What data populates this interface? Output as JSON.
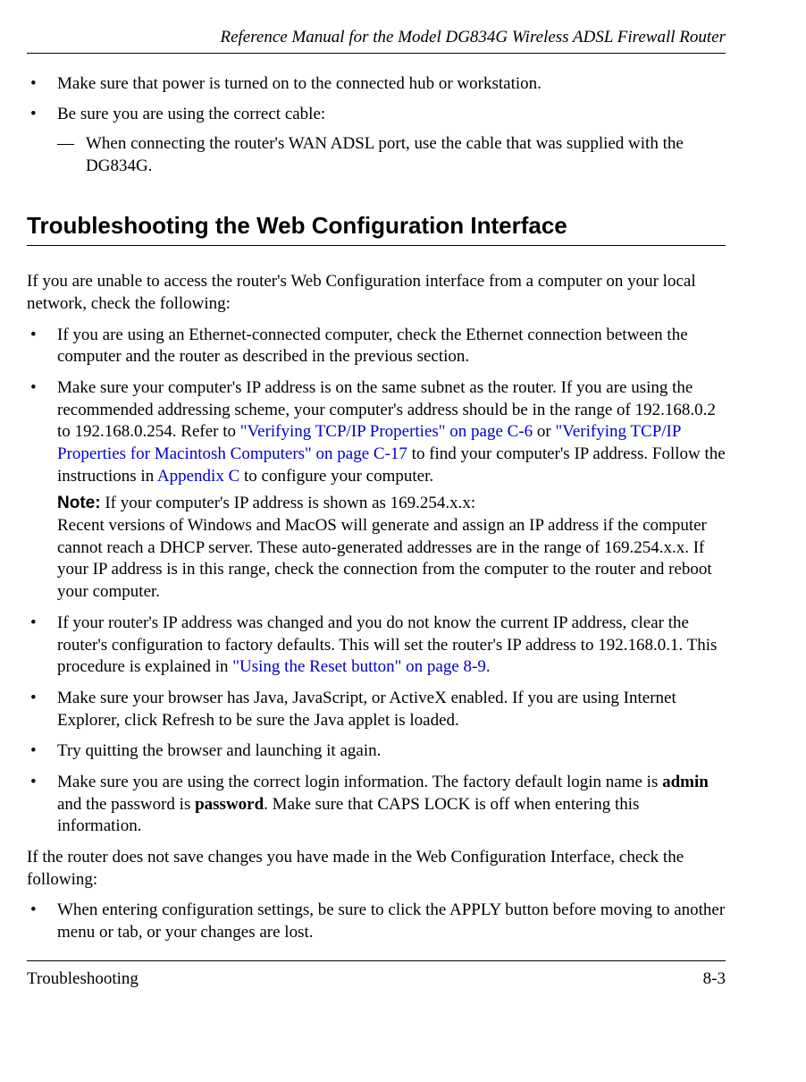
{
  "header": {
    "running_title": "Reference Manual for the Model DG834G Wireless ADSL Firewall Router"
  },
  "top_bullets": {
    "b1": "Make sure that power is turned on to the connected hub or workstation.",
    "b2": "Be sure you are using the correct cable:",
    "b2_dash": "When connecting the router's WAN ADSL port, use the cable that was supplied with the DG834G."
  },
  "section": {
    "title": "Troubleshooting the Web Configuration Interface"
  },
  "intro1": "If you are unable to access the router's Web Configuration interface from a computer on your local network, check the following:",
  "list1": {
    "i1": "If you are using an Ethernet-connected computer, check the Ethernet connection between the computer and the router as described in the previous section.",
    "i2_a": "Make sure your computer's IP address is on the same subnet as the router. If you are using the recommended addressing scheme, your computer's address should be in the range of 192.168.0.2 to 192.168.0.254. Refer to ",
    "i2_link1": "\"Verifying TCP/IP Properties\" on page C-6",
    "i2_b": " or ",
    "i2_link2": "\"Verifying TCP/IP Properties for Macintosh Computers\" on page C-17",
    "i2_c": " to find your computer's IP address. Follow the instructions in ",
    "i2_link3": "Appendix C",
    "i2_d": " to configure your computer.",
    "note_label": "Note:",
    "note_a": " If your computer's IP address is shown as 169.254.x.x:",
    "note_b": "Recent versions of Windows and MacOS will generate and assign an IP address if the computer cannot reach a DHCP server. These auto-generated addresses are in the range of 169.254.x.x. If your IP address is in this range, check the connection from the computer to the router and reboot your computer.",
    "i3_a": "If your router's IP address was changed and you do not know the current IP address, clear the router's configuration to factory defaults. This will set the router's IP address to 192.168.0.1. This procedure is explained in ",
    "i3_link": "\"Using the Reset button\" on page 8-9",
    "i3_b": ".",
    "i4": "Make sure your browser has Java, JavaScript, or ActiveX enabled. If you are using Internet Explorer, click Refresh to be sure the Java applet is loaded.",
    "i5": "Try quitting the browser and launching it again.",
    "i6_a": "Make sure you are using the correct login information. The factory default login name is ",
    "i6_admin": "admin",
    "i6_b": " and the password is ",
    "i6_pw": "password",
    "i6_c": ". Make sure that CAPS LOCK is off when entering this information."
  },
  "intro2": "If the router does not save changes you have made in the Web Configuration Interface, check the following:",
  "list2": {
    "i1": "When entering configuration settings, be sure to click the APPLY button before moving to another menu or tab, or your changes are lost."
  },
  "footer": {
    "left": "Troubleshooting",
    "right": "8-3"
  }
}
